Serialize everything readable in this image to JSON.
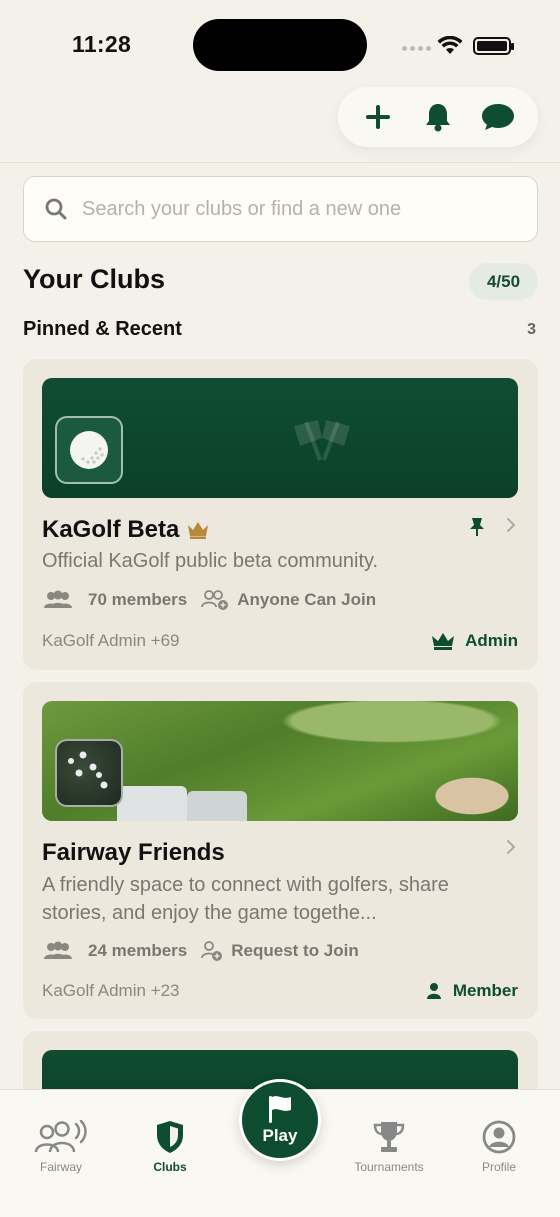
{
  "status_bar": {
    "time": "11:28"
  },
  "search": {
    "placeholder": "Search your clubs or find a new one"
  },
  "header": {
    "title": "Your Clubs",
    "club_count": "4/50"
  },
  "pinned": {
    "title": "Pinned & Recent",
    "count": "3"
  },
  "clubs": [
    {
      "name": "KaGolf Beta",
      "description": "Official KaGolf public beta community.",
      "members": "70 members",
      "join_policy": "Anyone Can Join",
      "admins": "KaGolf Admin +69",
      "role": "Admin",
      "pinned": true
    },
    {
      "name": "Fairway Friends",
      "description": "A friendly space to connect with golfers, share stories, and enjoy the game togethe...",
      "members": "24 members",
      "join_policy": "Request to Join",
      "admins": "KaGolf Admin +23",
      "role": "Member",
      "pinned": false
    }
  ],
  "tab_bar": {
    "tabs": [
      {
        "label": "Fairway",
        "icon": "people-wave-icon",
        "active": false
      },
      {
        "label": "Clubs",
        "icon": "shield-icon",
        "active": true
      },
      {
        "label": "Play",
        "icon": "flag-icon",
        "active": false
      },
      {
        "label": "Tournaments",
        "icon": "trophy-icon",
        "active": false
      },
      {
        "label": "Profile",
        "icon": "profile-icon",
        "active": false
      }
    ]
  },
  "colors": {
    "brand_green": "#0f4d31",
    "crown_gold": "#b8893a",
    "background": "#f4f1ea"
  }
}
